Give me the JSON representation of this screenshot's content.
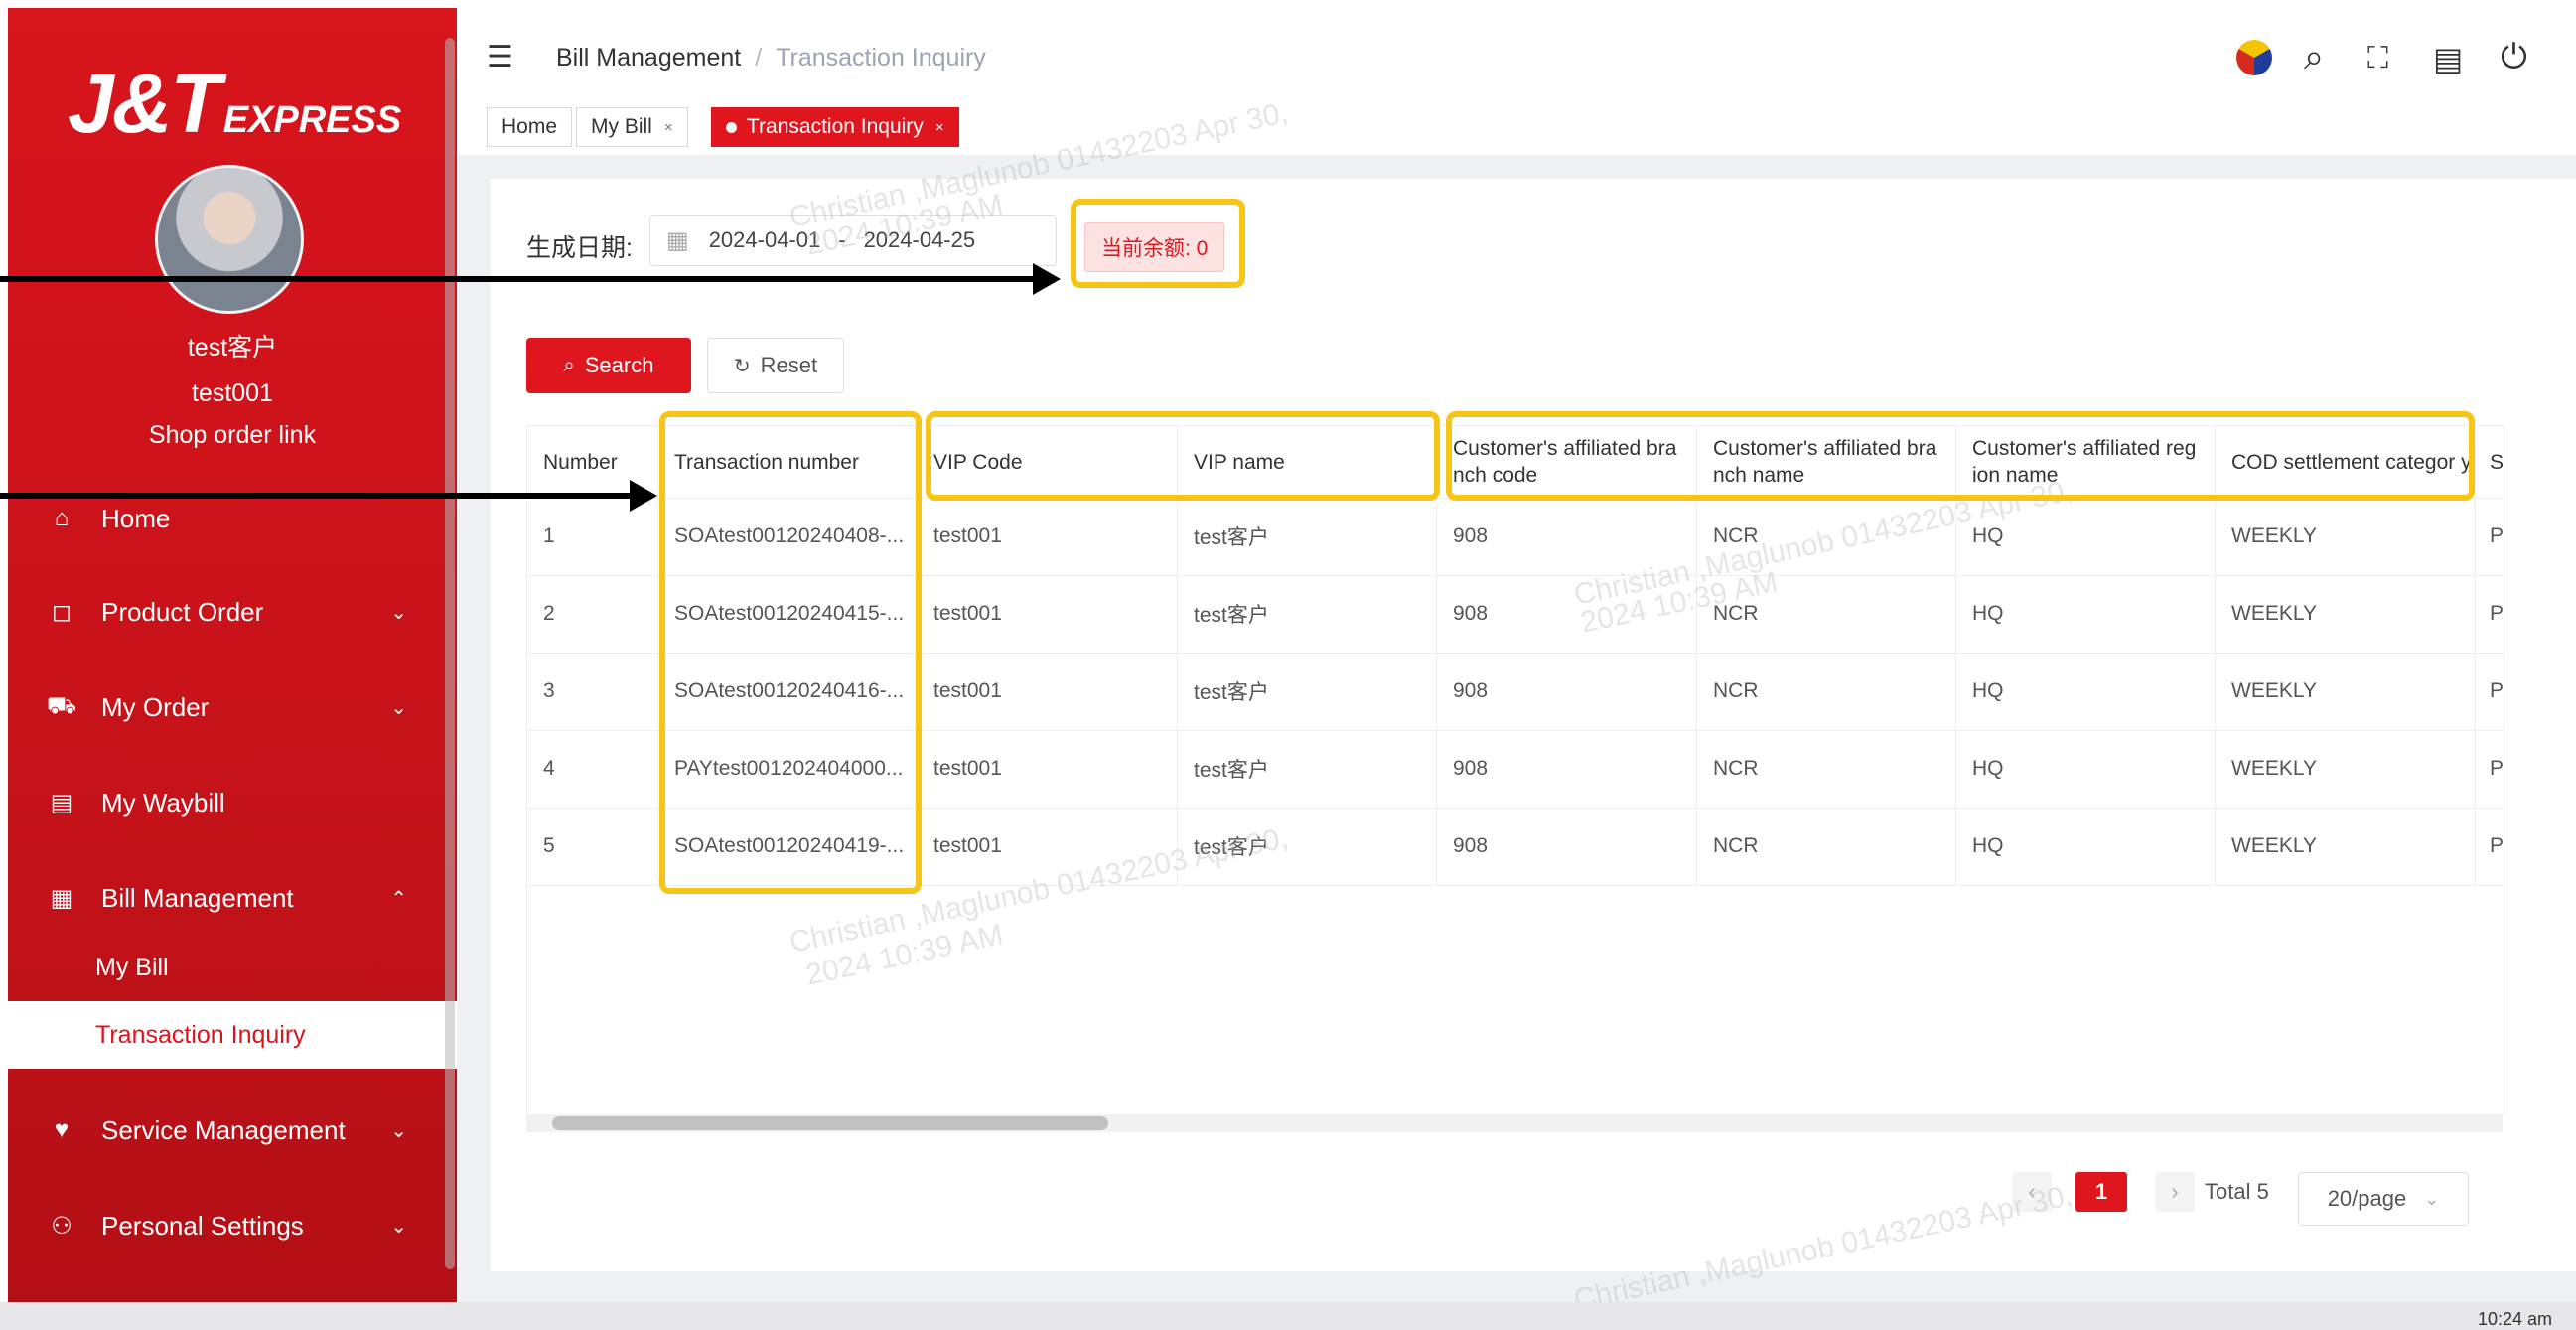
{
  "brand": {
    "logo_main": "J&T",
    "logo_sub": "EXPRESS"
  },
  "user": {
    "name": "test客户",
    "code": "test001",
    "shop_link": "Shop order link"
  },
  "sidebar": {
    "items": [
      {
        "label": "Home",
        "icon": "home-icon"
      },
      {
        "label": "Product Order",
        "icon": "bag-icon"
      },
      {
        "label": "My Order",
        "icon": "cart-icon"
      },
      {
        "label": "My Waybill",
        "icon": "waybill-icon"
      },
      {
        "label": "Bill Management",
        "icon": "grid-icon"
      },
      {
        "label": "Service Management",
        "icon": "heart-icon"
      },
      {
        "label": "Personal Settings",
        "icon": "people-icon"
      }
    ],
    "subitems": [
      {
        "label": "My Bill"
      },
      {
        "label": "Transaction Inquiry"
      }
    ]
  },
  "header": {
    "breadcrumb_parent": "Bill Management",
    "breadcrumb_sep": "/",
    "breadcrumb_current": "Transaction Inquiry",
    "icons": [
      "flag-icon",
      "search-icon",
      "fullscreen-icon",
      "calendar-icon",
      "power-icon"
    ]
  },
  "tabs": [
    {
      "label": "Home"
    },
    {
      "label": "My Bill",
      "close": "×"
    },
    {
      "label": "Transaction Inquiry",
      "close": "×",
      "active": true
    }
  ],
  "filter": {
    "date_label": "生成日期:",
    "date_start": "2024-04-01",
    "date_dash": "-",
    "date_end": "2024-04-25",
    "balance_label": "当前余额: 0",
    "search_label": "Search",
    "reset_label": "Reset"
  },
  "table": {
    "columns": [
      "Number",
      "Transaction number",
      "VIP Code",
      "VIP name",
      "Customer's affiliated bra nch code",
      "Customer's affiliated bra nch name",
      "Customer's affiliated reg ion name",
      "COD settlement categor y",
      "S"
    ],
    "rows": [
      [
        "1",
        "SOAtest00120240408-...",
        "test001",
        "test客户",
        "908",
        "NCR",
        "HQ",
        "WEEKLY",
        "P"
      ],
      [
        "2",
        "SOAtest00120240415-...",
        "test001",
        "test客户",
        "908",
        "NCR",
        "HQ",
        "WEEKLY",
        "P"
      ],
      [
        "3",
        "SOAtest00120240416-...",
        "test001",
        "test客户",
        "908",
        "NCR",
        "HQ",
        "WEEKLY",
        "P"
      ],
      [
        "4",
        "PAYtest001202404000...",
        "test001",
        "test客户",
        "908",
        "NCR",
        "HQ",
        "WEEKLY",
        "P"
      ],
      [
        "5",
        "SOAtest00120240419-...",
        "test001",
        "test客户",
        "908",
        "NCR",
        "HQ",
        "WEEKLY",
        "P"
      ]
    ]
  },
  "pagination": {
    "prev": "‹",
    "current": "1",
    "next": "›",
    "total": "Total 5",
    "page_size": "20/page"
  },
  "watermark": {
    "line1": "Christian ,Maglunob 01432203 Apr 30,",
    "line2": "2024 10:39 AM"
  },
  "taskbar": {
    "clock": "10:24 am"
  },
  "colors": {
    "brand_red": "#d8141c",
    "highlight_yellow": "#f5c518",
    "arrow": "#000000"
  }
}
